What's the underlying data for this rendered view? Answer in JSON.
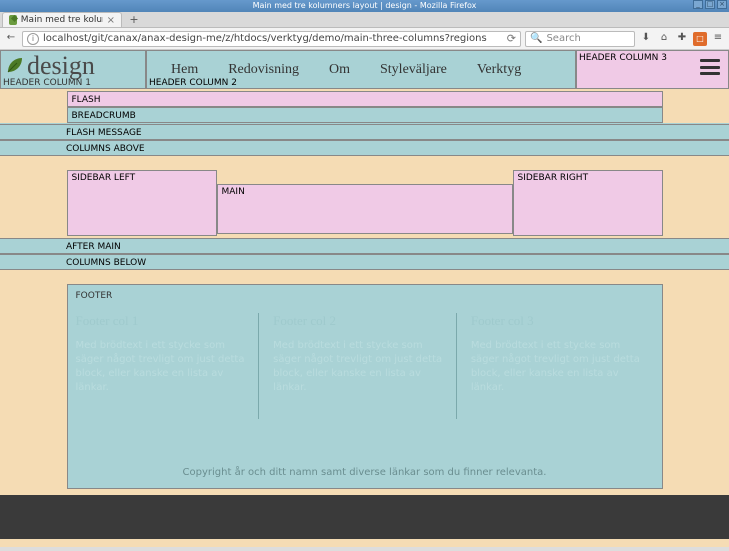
{
  "os": {
    "title": "Main med tre kolumners layout | design - Mozilla Firefox",
    "buttons": {
      "min": "_",
      "max": "□",
      "close": "×"
    }
  },
  "browser": {
    "tab_title": "Main med tre kolumner",
    "tab_close": "×",
    "newtab": "+",
    "back": "←",
    "info": "i",
    "url": "localhost/git/canax/anax-design-me/z/htdocs/verktyg/demo/main-three-columns?regions",
    "reload": "⟳",
    "search_placeholder": "Search",
    "search_icon": "🔍",
    "icons": {
      "download": "⬇",
      "home": "⌂",
      "pocket": "✚",
      "ext": "□",
      "menu": "≡"
    }
  },
  "page": {
    "brand": "design",
    "header": {
      "col1": "HEADER COLUMN 1",
      "col2": "HEADER COLUMN 2",
      "col3": "HEADER COLUMN 3"
    },
    "nav": [
      "Hem",
      "Redovisning",
      "Om",
      "Styleväljare",
      "Verktyg"
    ],
    "regions": {
      "flash": "FLASH",
      "breadcrumb": "BREADCRUMB",
      "flash_message": "FLASH MESSAGE",
      "columns_above": "COLUMNS ABOVE",
      "sidebar_left": "SIDEBAR LEFT",
      "main": "MAIN",
      "sidebar_right": "SIDEBAR RIGHT",
      "after_main": "AFTER MAIN",
      "columns_below": "COLUMNS BELOW",
      "footer": "FOOTER"
    },
    "footer_cols": [
      {
        "title": "Footer col 1",
        "body": "Med brödtext i ett stycke som säger något trevligt om just detta block, eller kanske en lista av länkar."
      },
      {
        "title": "Footer col 2",
        "body": "Med brödtext i ett stycke som säger något trevligt om just detta block, eller kanske en lista av länkar."
      },
      {
        "title": "Footer col 3",
        "body": "Med brödtext i ett stycke som säger något trevligt om just detta block, eller kanske en lista av länkar."
      }
    ],
    "copyright": "Copyright år och ditt namn samt diverse länkar som du finner relevanta."
  }
}
